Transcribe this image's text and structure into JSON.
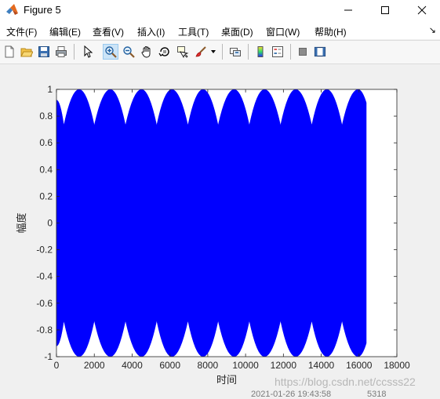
{
  "window": {
    "title": "Figure 5"
  },
  "menu": [
    {
      "label": "文件(F)"
    },
    {
      "label": "编辑(E)"
    },
    {
      "label": "查看(V)"
    },
    {
      "label": "插入(I)"
    },
    {
      "label": "工具(T)"
    },
    {
      "label": "桌面(D)"
    },
    {
      "label": "窗口(W)"
    },
    {
      "label": "帮助(H)"
    }
  ],
  "toolbar": {
    "items": [
      "new-figure-icon",
      "open-file-icon",
      "save-icon",
      "print-icon",
      "pointer-icon",
      "zoom-in-icon",
      "zoom-out-icon",
      "pan-icon",
      "rotate-3d-icon",
      "data-cursor-icon",
      "brush-icon",
      "brush-dropdown-icon",
      "link-plot-icon",
      "colorbar-icon",
      "legend-icon",
      "hide-plot-tools-icon",
      "show-plot-tools-icon"
    ],
    "active": "zoom-in-icon"
  },
  "chart_data": {
    "type": "area",
    "xlabel": "时间",
    "ylabel": "幅度",
    "xlim": [
      0,
      18000
    ],
    "ylim": [
      -1,
      1
    ],
    "xticks": [
      "0",
      "2000",
      "4000",
      "6000",
      "8000",
      "10000",
      "12000",
      "14000",
      "16000",
      "18000"
    ],
    "yticks": [
      "1",
      "0.8",
      "0.6",
      "0.4",
      "0.2",
      "0",
      "-0.2",
      "-0.4",
      "-0.6",
      "-0.8",
      "-1"
    ],
    "grid": false,
    "series": [
      {
        "color": "#0000ff",
        "x_range": [
          0,
          16384
        ],
        "envelope_x": [
          0,
          390,
          1200,
          2000,
          2850,
          3650,
          4500,
          5300,
          6100,
          6950,
          7750,
          8550,
          9400,
          10200,
          11000,
          11850,
          12650,
          13500,
          14300,
          15100,
          15950,
          16384
        ],
        "envelope_upper": [
          0.92,
          0.73,
          1,
          0.73,
          1,
          0.73,
          1,
          0.73,
          1,
          0.73,
          1,
          0.73,
          1,
          0.73,
          1,
          0.73,
          1,
          0.73,
          1,
          0.73,
          1,
          0.9
        ],
        "envelope_lower": [
          -0.92,
          -0.73,
          -1,
          -0.73,
          -1,
          -0.73,
          -1,
          -0.73,
          -1,
          -0.73,
          -1,
          -0.73,
          -1,
          -0.73,
          -1,
          -0.73,
          -1,
          -0.73,
          -1,
          -0.73,
          -1,
          -0.9
        ]
      }
    ]
  },
  "overlay": {
    "watermark": "https://blog.csdn.net/ccsss22",
    "date_text": "2021-01-26 19:43:58",
    "count_text": "5318"
  }
}
